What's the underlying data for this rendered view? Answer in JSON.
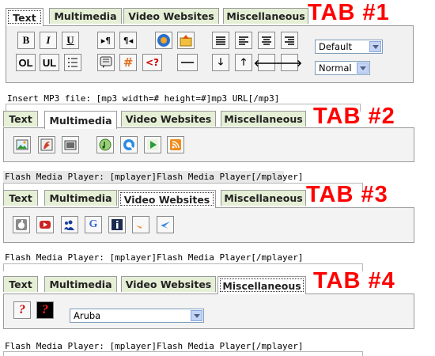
{
  "tabs": [
    "Text",
    "Multimedia",
    "Video Websites",
    "Miscellaneous"
  ],
  "labels": {
    "tab1": "TAB #1",
    "tab2": "TAB #2",
    "tab3": "TAB #3",
    "tab4": "TAB #4"
  },
  "text_toolbar": {
    "bold": "B",
    "italic": "I",
    "underline": "U",
    "ordered_list": "OL",
    "unordered_list": "UL",
    "font_select": "Default",
    "size_select": "Normal"
  },
  "misc_toolbar": {
    "country_select": "Aruba"
  },
  "captions": {
    "mp3": "Insert MP3 file: [mp3 width=# height=#]mp3 URL[/mp3]",
    "flash1": "Flash Media Player: [mplayer]Flash Media Player[/mplayer]",
    "flash2": "Flash Media Player: [mplayer]Flash Media Player[/mplayer]",
    "flash3": "Flash Media Player: [mplayer]Flash Media Player[/mplayer]"
  },
  "icons": {
    "text": [
      "bold-icon",
      "italic-icon",
      "underline-icon",
      "ltr-icon",
      "rtl-icon",
      "wordpress-icon",
      "upload-icon",
      "justify-icon",
      "align-left-icon",
      "align-center-icon",
      "align-right-icon",
      "ol-icon",
      "ul-icon",
      "list-icon",
      "quote-icon",
      "hash-icon",
      "php-icon",
      "hr-icon",
      "arrow-down-icon",
      "arrow-up-icon",
      "arrow-left-icon",
      "arrow-right-icon"
    ],
    "multimedia": [
      "image-icon",
      "flash-icon",
      "video-icon",
      "music-icon",
      "quicktime-icon",
      "play-icon",
      "rss-icon"
    ],
    "video_websites": [
      "apple-icon",
      "youtube-icon",
      "myspace-icon",
      "google-icon",
      "info-icon",
      "vimeo-icon",
      "dailymotion-icon"
    ],
    "misc": [
      "help-icon",
      "help-dark-icon"
    ]
  }
}
